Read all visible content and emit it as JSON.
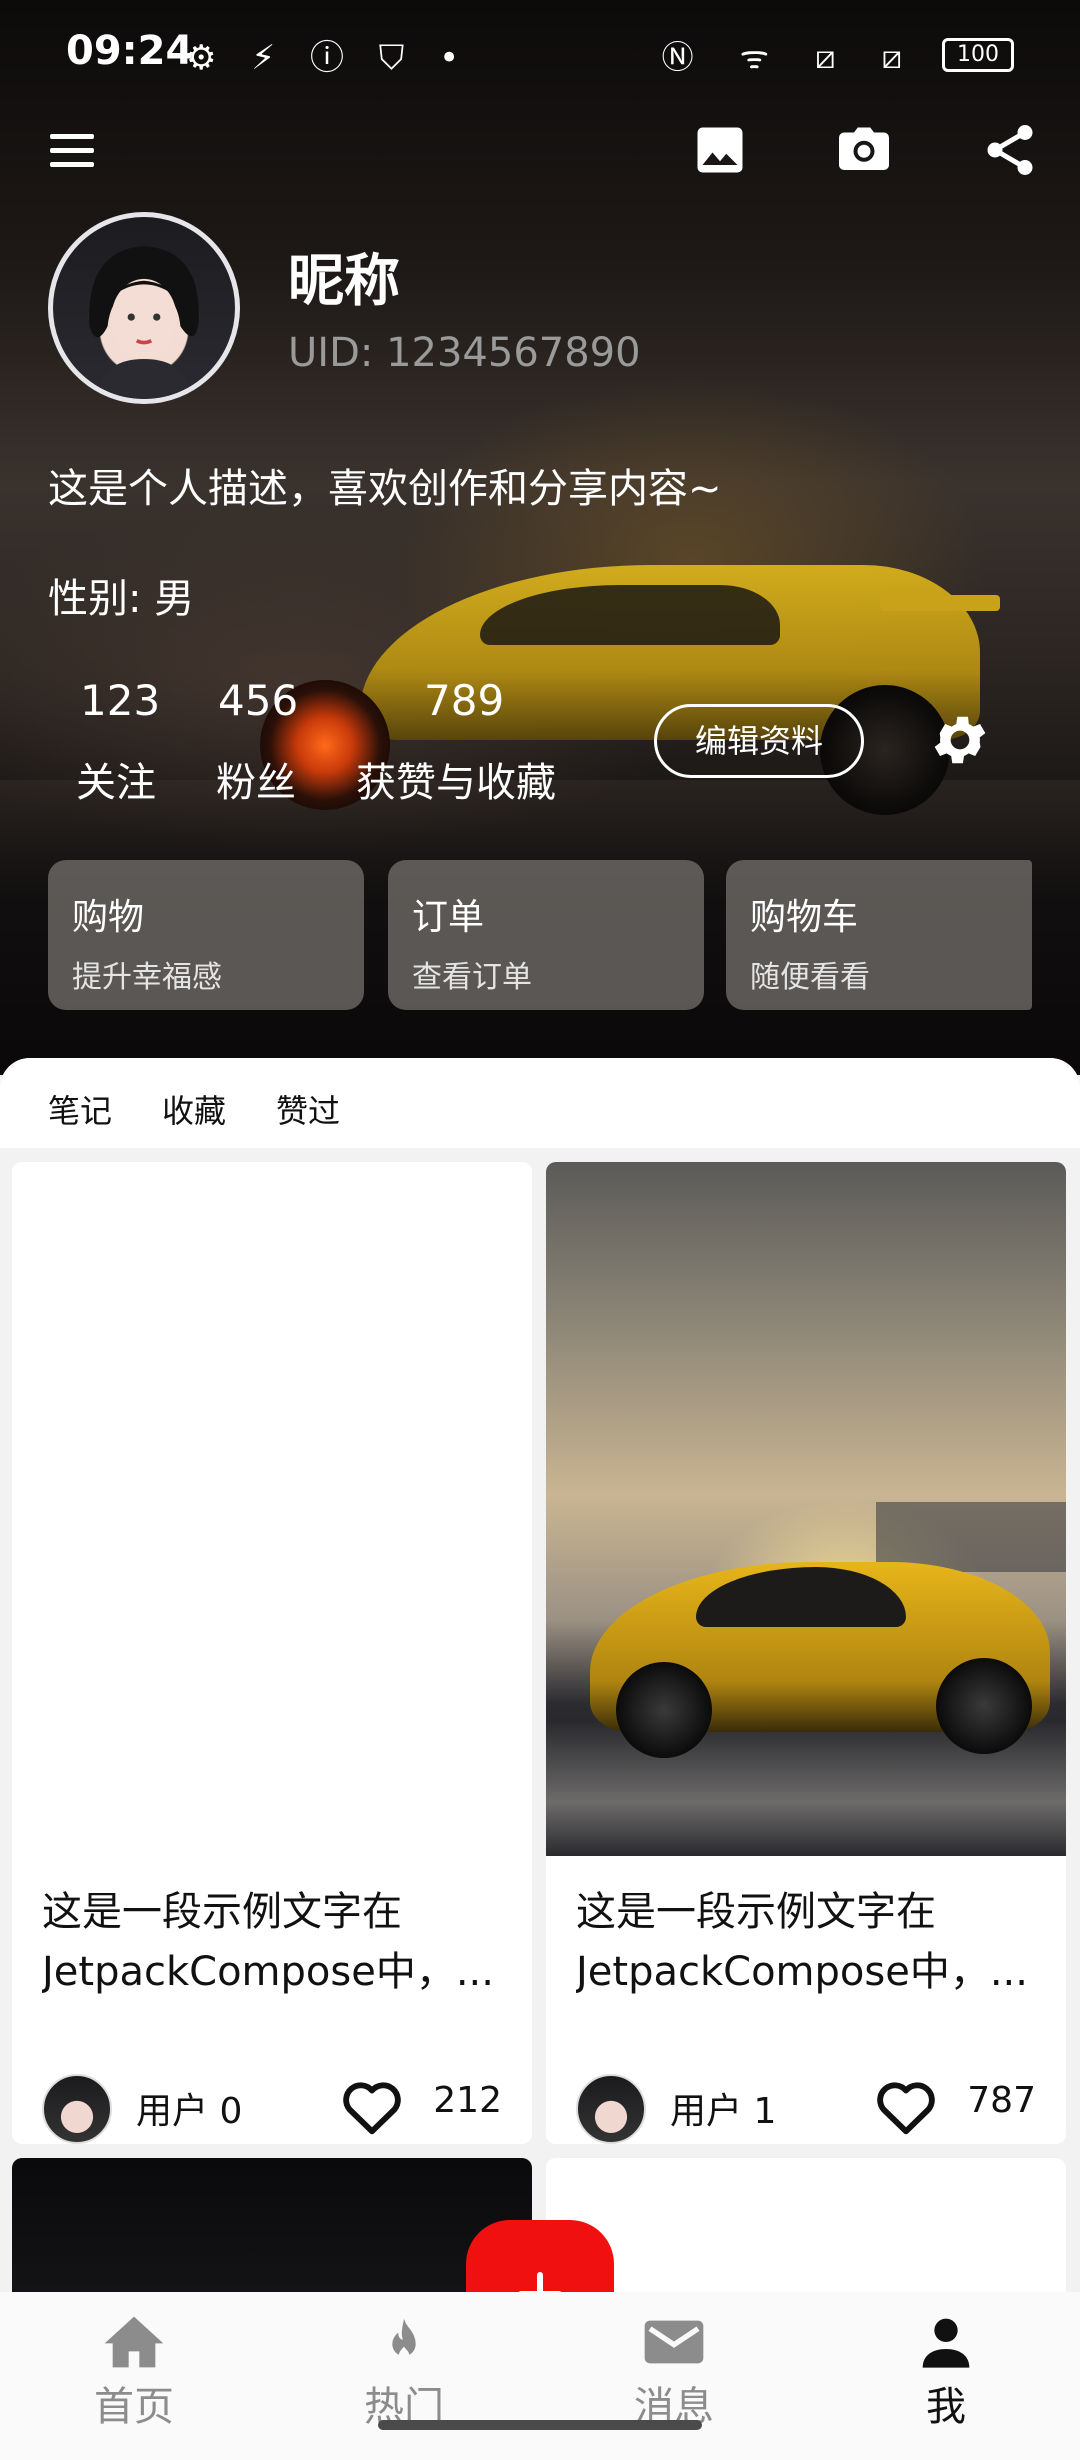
{
  "status_bar": {
    "time": "09:24",
    "left_icons": "⚙ ⚡ ⓘ ⛉ •",
    "right_icons": "Ⓝ ᯤ ⧄ ⧄",
    "battery": "100"
  },
  "profile": {
    "nickname": "昵称",
    "uid": "UID: 1234567890",
    "bio": "这是个人描述，喜欢创作和分享内容~",
    "gender": "性别: 男",
    "stats": [
      {
        "value": "123",
        "label": "关注"
      },
      {
        "value": "456",
        "label": "粉丝"
      },
      {
        "value": "789",
        "label": "获赞与收藏"
      }
    ],
    "edit_label": "编辑资料"
  },
  "quick_cards": [
    {
      "title": "购物",
      "subtitle": "提升幸福感"
    },
    {
      "title": "订单",
      "subtitle": "查看订单"
    },
    {
      "title": "购物车",
      "subtitle": "随便看看"
    }
  ],
  "tabs": [
    {
      "label": "笔记"
    },
    {
      "label": "收藏"
    },
    {
      "label": "赞过"
    }
  ],
  "posts": [
    {
      "line1": "这是一段示例文字在",
      "line2": "JetpackCompose中，...",
      "author": "用户  0",
      "likes": "212"
    },
    {
      "line1": "这是一段示例文字在",
      "line2": "JetpackCompose中，...",
      "author": "用户  1",
      "likes": "787"
    }
  ],
  "bottom_nav": [
    {
      "label": "首页",
      "icon": "home-icon"
    },
    {
      "label": "热门",
      "icon": "flame-icon"
    },
    {
      "label": "消息",
      "icon": "mail-icon"
    },
    {
      "label": "我",
      "icon": "person-icon"
    }
  ],
  "colors": {
    "accent_red": "#f01010",
    "uid_gray": "#9a9a9a",
    "nav_inactive": "#8c8c8c"
  }
}
